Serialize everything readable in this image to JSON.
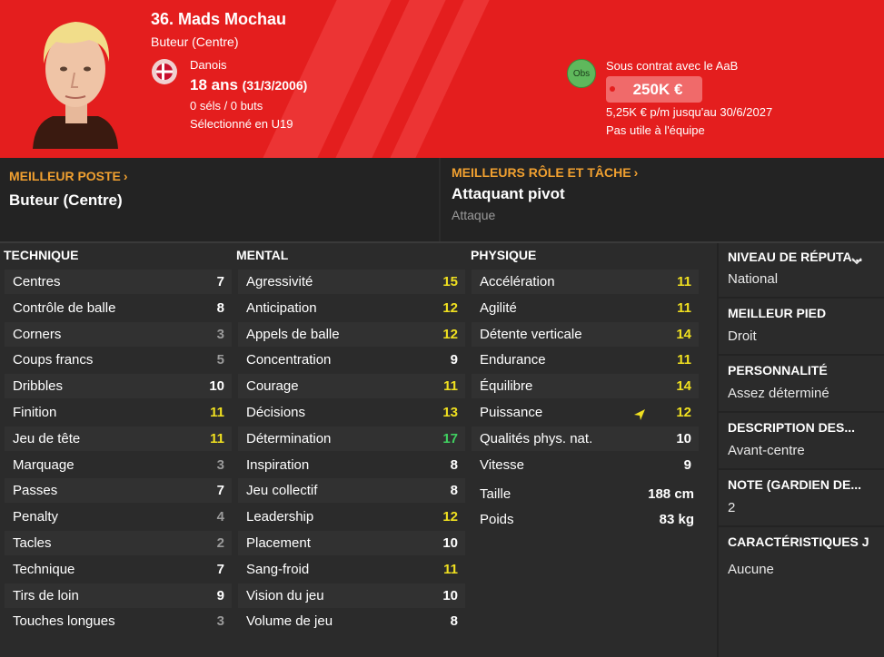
{
  "header": {
    "name": "36. Mads Mochau",
    "position": "Buteur (Centre)",
    "nationality": "Danois",
    "age": "18 ans",
    "birth": "(31/3/2006)",
    "caps": "0 séls / 0 buts",
    "selection": "Sélectionné en U19",
    "obs_badge": "Obs",
    "contract": "Sous contrat avec le AaB",
    "value": "250K €",
    "wage": "5,25K € p/m jusqu'au 30/6/2027",
    "usefulness": "Pas utile à l'équipe",
    "colors": {
      "header": "#e41e1e",
      "accent": "#f0a030"
    }
  },
  "best_position": {
    "title": "MEILLEUR POSTE",
    "value": "Buteur (Centre)"
  },
  "best_role": {
    "title": "MEILLEURS RÔLE ET TÂCHE",
    "value": "Attaquant pivot",
    "sub": "Attaque"
  },
  "columns": {
    "technique": "TECHNIQUE",
    "mental": "MENTAL",
    "physique": "PHYSIQUE"
  },
  "technique": [
    {
      "label": "Centres",
      "value": "7"
    },
    {
      "label": "Contrôle de balle",
      "value": "8"
    },
    {
      "label": "Corners",
      "value": "3"
    },
    {
      "label": "Coups francs",
      "value": "5"
    },
    {
      "label": "Dribbles",
      "value": "10"
    },
    {
      "label": "Finition",
      "value": "11"
    },
    {
      "label": "Jeu de tête",
      "value": "11"
    },
    {
      "label": "Marquage",
      "value": "3"
    },
    {
      "label": "Passes",
      "value": "7"
    },
    {
      "label": "Penalty",
      "value": "4"
    },
    {
      "label": "Tacles",
      "value": "2"
    },
    {
      "label": "Technique",
      "value": "7"
    },
    {
      "label": "Tirs de loin",
      "value": "9"
    },
    {
      "label": "Touches longues",
      "value": "3"
    }
  ],
  "mental": [
    {
      "label": "Agressivité",
      "value": "15"
    },
    {
      "label": "Anticipation",
      "value": "12"
    },
    {
      "label": "Appels de balle",
      "value": "12"
    },
    {
      "label": "Concentration",
      "value": "9"
    },
    {
      "label": "Courage",
      "value": "11"
    },
    {
      "label": "Décisions",
      "value": "13"
    },
    {
      "label": "Détermination",
      "value": "17"
    },
    {
      "label": "Inspiration",
      "value": "8"
    },
    {
      "label": "Jeu collectif",
      "value": "8"
    },
    {
      "label": "Leadership",
      "value": "12"
    },
    {
      "label": "Placement",
      "value": "10"
    },
    {
      "label": "Sang-froid",
      "value": "11"
    },
    {
      "label": "Vision du jeu",
      "value": "10"
    },
    {
      "label": "Volume de jeu",
      "value": "8"
    }
  ],
  "physique": [
    {
      "label": "Accélération",
      "value": "11"
    },
    {
      "label": "Agilité",
      "value": "11"
    },
    {
      "label": "Détente verticale",
      "value": "14"
    },
    {
      "label": "Endurance",
      "value": "11"
    },
    {
      "label": "Équilibre",
      "value": "14"
    },
    {
      "label": "Puissance",
      "value": "12"
    },
    {
      "label": "Qualités phys. nat.",
      "value": "10"
    },
    {
      "label": "Vitesse",
      "value": "9"
    }
  ],
  "body": {
    "height_label": "Taille",
    "height": "188 cm",
    "weight_label": "Poids",
    "weight": "83 kg"
  },
  "info": [
    {
      "title": "NIVEAU DE RÉPUTA...",
      "value": "National"
    },
    {
      "title": "MEILLEUR PIED",
      "value": "Droit"
    },
    {
      "title": "PERSONNALITÉ",
      "value": "Assez déterminé"
    },
    {
      "title": "DESCRIPTION DES...",
      "value": "Avant-centre"
    },
    {
      "title": "NOTE (GARDIEN DE...",
      "value": "2"
    },
    {
      "title": "CARACTÉRISTIQUES J",
      "value": "Aucune"
    }
  ]
}
